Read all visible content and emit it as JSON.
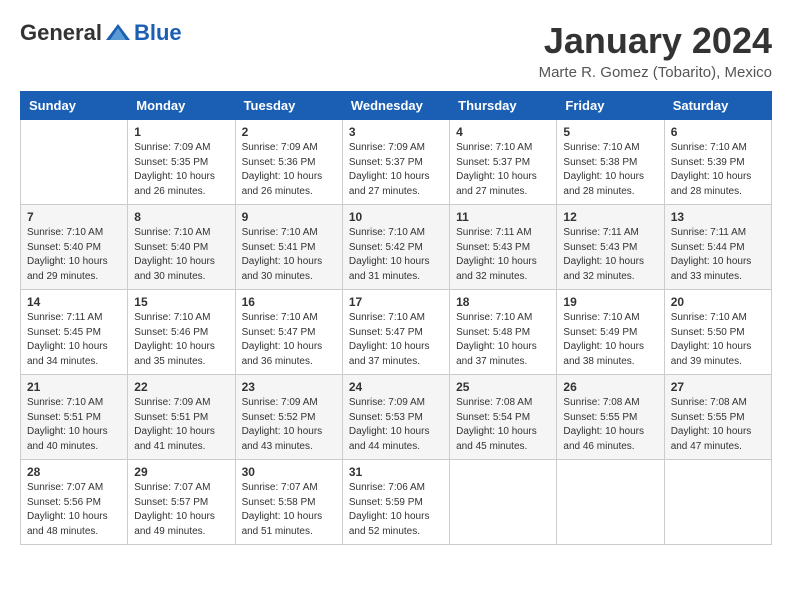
{
  "logo": {
    "general": "General",
    "blue": "Blue"
  },
  "title": "January 2024",
  "location": "Marte R. Gomez (Tobarito), Mexico",
  "days_of_week": [
    "Sunday",
    "Monday",
    "Tuesday",
    "Wednesday",
    "Thursday",
    "Friday",
    "Saturday"
  ],
  "weeks": [
    [
      {
        "day": "",
        "sunrise": "",
        "sunset": "",
        "daylight": ""
      },
      {
        "day": "1",
        "sunrise": "Sunrise: 7:09 AM",
        "sunset": "Sunset: 5:35 PM",
        "daylight": "Daylight: 10 hours and 26 minutes."
      },
      {
        "day": "2",
        "sunrise": "Sunrise: 7:09 AM",
        "sunset": "Sunset: 5:36 PM",
        "daylight": "Daylight: 10 hours and 26 minutes."
      },
      {
        "day": "3",
        "sunrise": "Sunrise: 7:09 AM",
        "sunset": "Sunset: 5:37 PM",
        "daylight": "Daylight: 10 hours and 27 minutes."
      },
      {
        "day": "4",
        "sunrise": "Sunrise: 7:10 AM",
        "sunset": "Sunset: 5:37 PM",
        "daylight": "Daylight: 10 hours and 27 minutes."
      },
      {
        "day": "5",
        "sunrise": "Sunrise: 7:10 AM",
        "sunset": "Sunset: 5:38 PM",
        "daylight": "Daylight: 10 hours and 28 minutes."
      },
      {
        "day": "6",
        "sunrise": "Sunrise: 7:10 AM",
        "sunset": "Sunset: 5:39 PM",
        "daylight": "Daylight: 10 hours and 28 minutes."
      }
    ],
    [
      {
        "day": "7",
        "sunrise": "Sunrise: 7:10 AM",
        "sunset": "Sunset: 5:40 PM",
        "daylight": "Daylight: 10 hours and 29 minutes."
      },
      {
        "day": "8",
        "sunrise": "Sunrise: 7:10 AM",
        "sunset": "Sunset: 5:40 PM",
        "daylight": "Daylight: 10 hours and 30 minutes."
      },
      {
        "day": "9",
        "sunrise": "Sunrise: 7:10 AM",
        "sunset": "Sunset: 5:41 PM",
        "daylight": "Daylight: 10 hours and 30 minutes."
      },
      {
        "day": "10",
        "sunrise": "Sunrise: 7:10 AM",
        "sunset": "Sunset: 5:42 PM",
        "daylight": "Daylight: 10 hours and 31 minutes."
      },
      {
        "day": "11",
        "sunrise": "Sunrise: 7:11 AM",
        "sunset": "Sunset: 5:43 PM",
        "daylight": "Daylight: 10 hours and 32 minutes."
      },
      {
        "day": "12",
        "sunrise": "Sunrise: 7:11 AM",
        "sunset": "Sunset: 5:43 PM",
        "daylight": "Daylight: 10 hours and 32 minutes."
      },
      {
        "day": "13",
        "sunrise": "Sunrise: 7:11 AM",
        "sunset": "Sunset: 5:44 PM",
        "daylight": "Daylight: 10 hours and 33 minutes."
      }
    ],
    [
      {
        "day": "14",
        "sunrise": "Sunrise: 7:11 AM",
        "sunset": "Sunset: 5:45 PM",
        "daylight": "Daylight: 10 hours and 34 minutes."
      },
      {
        "day": "15",
        "sunrise": "Sunrise: 7:10 AM",
        "sunset": "Sunset: 5:46 PM",
        "daylight": "Daylight: 10 hours and 35 minutes."
      },
      {
        "day": "16",
        "sunrise": "Sunrise: 7:10 AM",
        "sunset": "Sunset: 5:47 PM",
        "daylight": "Daylight: 10 hours and 36 minutes."
      },
      {
        "day": "17",
        "sunrise": "Sunrise: 7:10 AM",
        "sunset": "Sunset: 5:47 PM",
        "daylight": "Daylight: 10 hours and 37 minutes."
      },
      {
        "day": "18",
        "sunrise": "Sunrise: 7:10 AM",
        "sunset": "Sunset: 5:48 PM",
        "daylight": "Daylight: 10 hours and 37 minutes."
      },
      {
        "day": "19",
        "sunrise": "Sunrise: 7:10 AM",
        "sunset": "Sunset: 5:49 PM",
        "daylight": "Daylight: 10 hours and 38 minutes."
      },
      {
        "day": "20",
        "sunrise": "Sunrise: 7:10 AM",
        "sunset": "Sunset: 5:50 PM",
        "daylight": "Daylight: 10 hours and 39 minutes."
      }
    ],
    [
      {
        "day": "21",
        "sunrise": "Sunrise: 7:10 AM",
        "sunset": "Sunset: 5:51 PM",
        "daylight": "Daylight: 10 hours and 40 minutes."
      },
      {
        "day": "22",
        "sunrise": "Sunrise: 7:09 AM",
        "sunset": "Sunset: 5:51 PM",
        "daylight": "Daylight: 10 hours and 41 minutes."
      },
      {
        "day": "23",
        "sunrise": "Sunrise: 7:09 AM",
        "sunset": "Sunset: 5:52 PM",
        "daylight": "Daylight: 10 hours and 43 minutes."
      },
      {
        "day": "24",
        "sunrise": "Sunrise: 7:09 AM",
        "sunset": "Sunset: 5:53 PM",
        "daylight": "Daylight: 10 hours and 44 minutes."
      },
      {
        "day": "25",
        "sunrise": "Sunrise: 7:08 AM",
        "sunset": "Sunset: 5:54 PM",
        "daylight": "Daylight: 10 hours and 45 minutes."
      },
      {
        "day": "26",
        "sunrise": "Sunrise: 7:08 AM",
        "sunset": "Sunset: 5:55 PM",
        "daylight": "Daylight: 10 hours and 46 minutes."
      },
      {
        "day": "27",
        "sunrise": "Sunrise: 7:08 AM",
        "sunset": "Sunset: 5:55 PM",
        "daylight": "Daylight: 10 hours and 47 minutes."
      }
    ],
    [
      {
        "day": "28",
        "sunrise": "Sunrise: 7:07 AM",
        "sunset": "Sunset: 5:56 PM",
        "daylight": "Daylight: 10 hours and 48 minutes."
      },
      {
        "day": "29",
        "sunrise": "Sunrise: 7:07 AM",
        "sunset": "Sunset: 5:57 PM",
        "daylight": "Daylight: 10 hours and 49 minutes."
      },
      {
        "day": "30",
        "sunrise": "Sunrise: 7:07 AM",
        "sunset": "Sunset: 5:58 PM",
        "daylight": "Daylight: 10 hours and 51 minutes."
      },
      {
        "day": "31",
        "sunrise": "Sunrise: 7:06 AM",
        "sunset": "Sunset: 5:59 PM",
        "daylight": "Daylight: 10 hours and 52 minutes."
      },
      {
        "day": "",
        "sunrise": "",
        "sunset": "",
        "daylight": ""
      },
      {
        "day": "",
        "sunrise": "",
        "sunset": "",
        "daylight": ""
      },
      {
        "day": "",
        "sunrise": "",
        "sunset": "",
        "daylight": ""
      }
    ]
  ]
}
